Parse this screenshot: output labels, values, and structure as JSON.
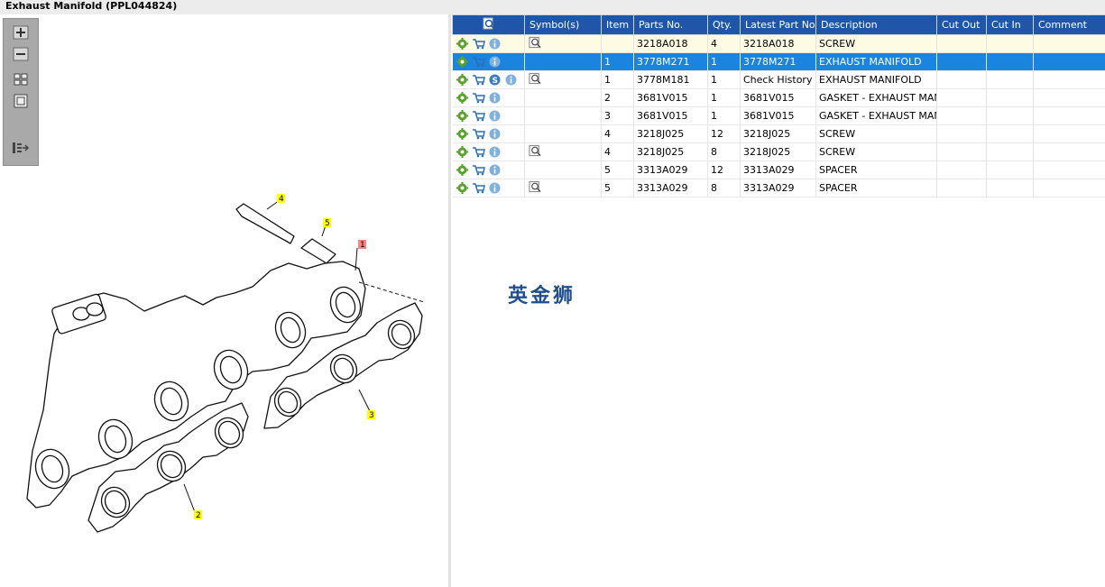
{
  "window": {
    "title": "Exhaust Manifold (PPL044824)"
  },
  "columns": [
    "Symbol(s)",
    "Item",
    "Parts No.",
    "Qty.",
    "Latest Part No.",
    "Description",
    "Cut Out",
    "Cut In",
    "Comment"
  ],
  "rows": [
    {
      "item": "",
      "part": "3218A018",
      "qty": "4",
      "latest": "3218A018",
      "desc": "SCREW",
      "s": false,
      "sym": true
    },
    {
      "item": "1",
      "part": "3778M271",
      "qty": "1",
      "latest": "3778M271",
      "desc": "EXHAUST MANIFOLD",
      "s": false,
      "sym": false
    },
    {
      "item": "1",
      "part": "3778M181",
      "qty": "1",
      "latest": "Check History",
      "desc": "EXHAUST MANIFOLD",
      "s": true,
      "sym": true
    },
    {
      "item": "2",
      "part": "3681V015",
      "qty": "1",
      "latest": "3681V015",
      "desc": "GASKET - EXHAUST MANIF",
      "s": false,
      "sym": false
    },
    {
      "item": "3",
      "part": "3681V015",
      "qty": "1",
      "latest": "3681V015",
      "desc": "GASKET - EXHAUST MANIF",
      "s": false,
      "sym": false
    },
    {
      "item": "4",
      "part": "3218J025",
      "qty": "12",
      "latest": "3218J025",
      "desc": "SCREW",
      "s": false,
      "sym": false
    },
    {
      "item": "4",
      "part": "3218J025",
      "qty": "8",
      "latest": "3218J025",
      "desc": "SCREW",
      "s": false,
      "sym": true
    },
    {
      "item": "5",
      "part": "3313A029",
      "qty": "12",
      "latest": "3313A029",
      "desc": "SPACER",
      "s": false,
      "sym": false
    },
    {
      "item": "5",
      "part": "3313A029",
      "qty": "8",
      "latest": "3313A029",
      "desc": "SPACER",
      "s": false,
      "sym": true
    }
  ],
  "highlight_row": 0,
  "selected_row": 1,
  "callouts": [
    "1",
    "2",
    "3",
    "4",
    "5"
  ],
  "watermark": "英金狮",
  "colors": {
    "header": "#1f56a7",
    "selected": "#1a84de",
    "highlight": "#fdfbe4",
    "callout_yellow": "#ffff00",
    "callout_red": "#ff8080"
  },
  "toolbar_icons": [
    "zoom-in-icon",
    "zoom-out-icon",
    "fit-page-icon",
    "actual-size-icon",
    "toggle-panel-icon"
  ]
}
